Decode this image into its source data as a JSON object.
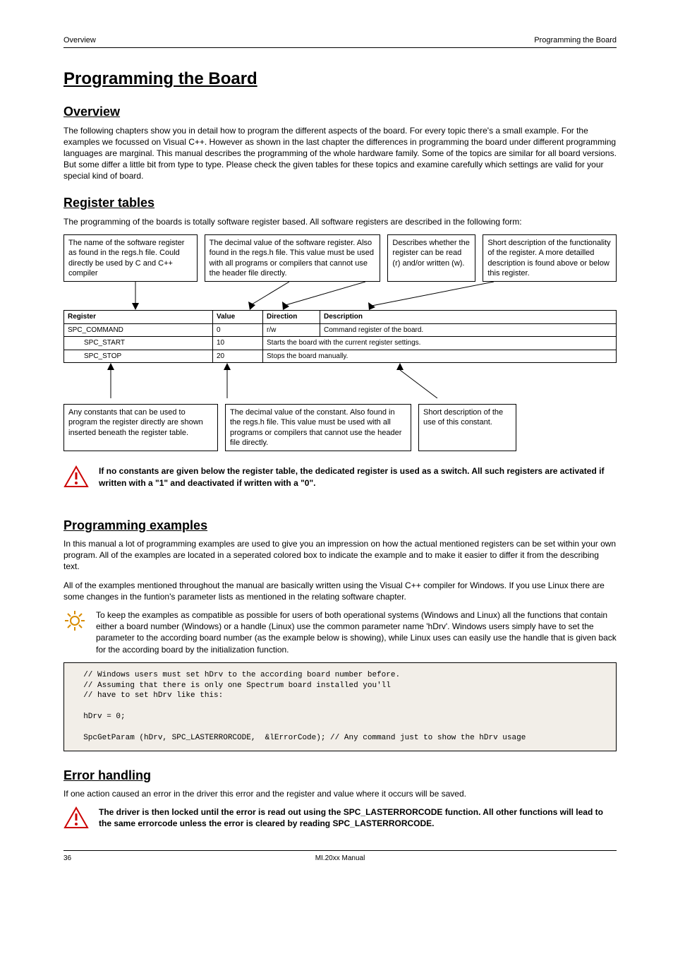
{
  "header": {
    "left": "Overview",
    "right": "Programming the Board"
  },
  "h1": "Programming the Board",
  "overview": {
    "title": "Overview",
    "body": "The following chapters show you in detail how to program the different aspects of the board. For every topic there's a small example. For the examples we focussed on Visual C++. However as shown in the last chapter the differences in programming the board under different programming languages are marginal. This manual describes the programming of the whole hardware family. Some of the topics are similar for all board versions. But some differ a little bit from type to type. Please check the given tables for these topics and examine carefully which settings are valid for your special kind of board."
  },
  "regtables": {
    "title": "Register tables",
    "intro": "The programming of the boards is totally software register based. All software registers are described in the following form:",
    "topboxes": [
      "The name of the software register as found in the regs.h file. Could directly be used by C and C++ compiler",
      "The decimal value of the software register. Also found in the regs.h file. This value must be used with all programs or compilers that cannot use the header file directly.",
      "Describes whether the register can be read (r) and/or written (w).",
      "Short description of the functionality of the register. A more detailled description is found above or below this register."
    ],
    "table": {
      "headers": [
        "Register",
        "Value",
        "Direction",
        "Description"
      ],
      "rows": [
        [
          "SPC_COMMAND",
          "0",
          "r/w",
          "Command register of the board."
        ],
        [
          "SPC_START",
          "10",
          "Starts the board with the current register settings."
        ],
        [
          "SPC_STOP",
          "20",
          "Stops the board manually."
        ]
      ]
    },
    "bottomboxes": [
      "Any constants that can be used to program the register directly are shown inserted beneath the register table.",
      "The decimal value of the constant. Also found in the regs.h file. This value must be used with all programs or compilers that cannot use the header file directly.",
      "Short description of the use of this constant."
    ],
    "note": "If no constants are given below the register table, the dedicated register is used as a switch. All such registers are activated if written with a \"1\" and deactivated if written with a \"0\"."
  },
  "progex": {
    "title": "Programming examples",
    "p1": "In this manual a lot of programming examples are used to give you an impression on how the actual mentioned registers can be set within your own program. All of the examples are located in a seperated colored box to indicate the example and to make it easier to differ it from the describing text.",
    "p2": "All of the examples mentioned throughout the manual are basically written using the Visual C++ compiler for Windows. If you use Linux there are some changes in the funtion's parameter lists as mentioned in the relating software chapter.",
    "p3": "To keep the examples as compatible as possible for users of both operational systems (Windows and Linux) all the functions that contain either a board number (Windows) or a handle (Linux) use the common parameter name 'hDrv'. Windows users simply have to set the parameter to the according board number (as the example below is showing), while Linux uses can easily use the handle that is given back for the according board by the initialization function.",
    "code": "  // Windows users must set hDrv to the according board number before.\n  // Assuming that there is only one Spectrum board installed you'll\n  // have to set hDrv like this:\n\n  hDrv = 0;\n\n  SpcGetParam (hDrv, SPC_LASTERRORCODE,  &lErrorCode); // Any command just to show the hDrv usage"
  },
  "err": {
    "title": "Error handling",
    "p1": "If one action caused an error in the driver this error and the register and value where it occurs will be saved.",
    "note": "The driver is then locked until the error is read out using the SPC_LASTERRORCODE function. All other functions will lead to the same errorcode unless the error is cleared by reading SPC_LASTERRORCODE."
  },
  "footer": {
    "left": "36",
    "center": "MI.20xx Manual"
  }
}
